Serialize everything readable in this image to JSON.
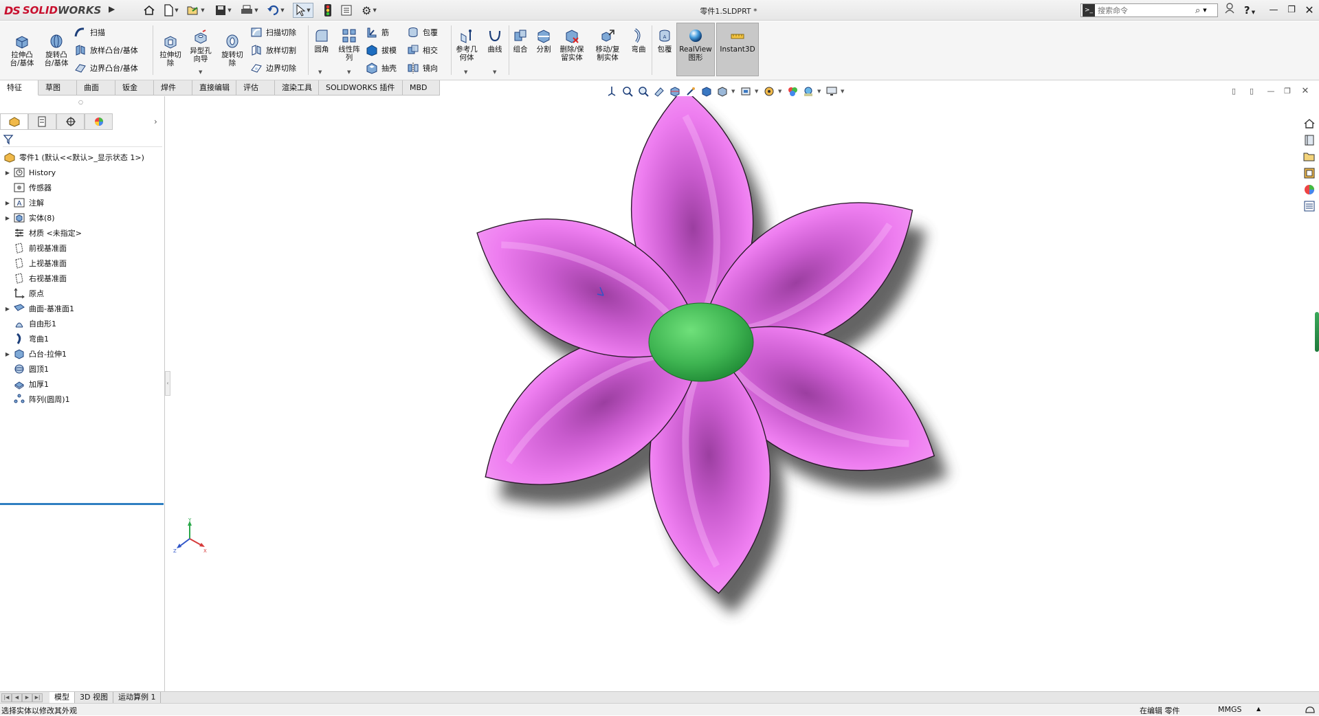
{
  "app": {
    "logo_prefix": "DS",
    "logo_solid": "SOLID",
    "logo_works": "WORKS",
    "document_title": "零件1.SLDPRT *",
    "search_placeholder": "搜索命令",
    "icons": [
      "home-icon",
      "new-icon",
      "open-icon",
      "save-icon",
      "print-icon",
      "undo-icon",
      "select-icon",
      "traffic-light-icon",
      "file-properties-icon",
      "options-gear-icon",
      "user-icon",
      "help-icon",
      "minimize-icon",
      "restore-icon",
      "close-icon"
    ]
  },
  "ribbon": {
    "features": {
      "extrude_boss": "拉伸凸\n台/基体",
      "revolve_boss": "旋转凸\n台/基体",
      "sweep": "扫描",
      "loft_boss": "放样凸台/基体",
      "boundary_boss": "边界凸台/基体",
      "extrude_cut": "拉伸切\n除",
      "hole_wizard": "异型孔\n向导",
      "revolve_cut": "旋转切\n除",
      "swept_cut": "扫描切除",
      "lofted_cut": "放样切割",
      "boundary_cut": "边界切除",
      "fillet": "圆角",
      "linear_pattern": "线性阵\n列",
      "rib": "筋",
      "draft": "拔模",
      "shell": "抽壳",
      "wrap": "包覆",
      "intersect": "相交",
      "mirror": "镜向",
      "ref_geometry": "参考几\n何体",
      "curves": "曲线",
      "combine": "组合",
      "split": "分割",
      "delete_keep_body": "删除/保\n留实体",
      "move_copy_body": "移动/复\n制实体",
      "flex": "弯曲",
      "wrap2": "包覆",
      "realview": "RealView\n图形",
      "instant3d": "Instant3D"
    }
  },
  "command_tabs": [
    "特征",
    "草图",
    "曲面",
    "钣金",
    "焊件",
    "直接编辑",
    "评估",
    "渲染工具",
    "SOLIDWORKS 插件",
    "MBD"
  ],
  "feature_tree": {
    "root": "零件1 (默认<<默认>_显示状态 1>)",
    "items": [
      {
        "label": "History",
        "icon": "history-icon",
        "expandable": true
      },
      {
        "label": "传感器",
        "icon": "sensor-icon",
        "expandable": false
      },
      {
        "label": "注解",
        "icon": "annotation-icon",
        "expandable": true
      },
      {
        "label": "实体(8)",
        "icon": "solid-bodies-icon",
        "expandable": true
      },
      {
        "label": "材质 <未指定>",
        "icon": "material-icon",
        "expandable": false
      },
      {
        "label": "前视基准面",
        "icon": "plane-icon",
        "expandable": false
      },
      {
        "label": "上视基准面",
        "icon": "plane-icon",
        "expandable": false
      },
      {
        "label": "右视基准面",
        "icon": "plane-icon",
        "expandable": false
      },
      {
        "label": "原点",
        "icon": "origin-icon",
        "expandable": false
      },
      {
        "label": "曲面-基准面1",
        "icon": "surface-plane-icon",
        "expandable": true
      },
      {
        "label": "自由形1",
        "icon": "freeform-icon",
        "expandable": false
      },
      {
        "label": "弯曲1",
        "icon": "flex-icon",
        "expandable": false
      },
      {
        "label": "凸台-拉伸1",
        "icon": "boss-extrude-icon",
        "expandable": true
      },
      {
        "label": "圆顶1",
        "icon": "dome-icon",
        "expandable": false
      },
      {
        "label": "加厚1",
        "icon": "thicken-icon",
        "expandable": false
      },
      {
        "label": "阵列(圆周)1",
        "icon": "circular-pattern-icon",
        "expandable": false
      }
    ]
  },
  "bottom_tabs": [
    "模型",
    "3D 视图",
    "运动算例 1"
  ],
  "status": {
    "message": "选择实体以修改其外观",
    "editing": "在编辑 零件",
    "units": "MMGS"
  },
  "colors": {
    "petal": "#ee7ef0",
    "petal_dark": "#a545a8",
    "center": "#46c35a",
    "shadow": "#4a4a4a",
    "accent_blue": "#2f7fc1",
    "logo_red": "#c8102e"
  }
}
